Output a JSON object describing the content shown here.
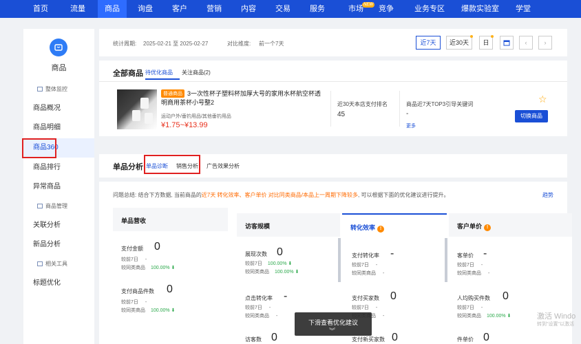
{
  "nav": {
    "items": [
      "首页",
      "流量",
      "商品",
      "询盘",
      "客户",
      "营销",
      "内容",
      "交易",
      "服务",
      "市场",
      "竞争",
      "业务专区",
      "爆款实验室",
      "学堂"
    ],
    "active_index": 2,
    "new_badge": "NEW"
  },
  "sidebar": {
    "brand_label": "商品",
    "items": [
      {
        "label": "整体监控",
        "group": true
      },
      {
        "label": "商品概况"
      },
      {
        "label": "商品明细"
      },
      {
        "label": "商品360",
        "active": true
      },
      {
        "label": "商品排行"
      },
      {
        "label": "异常商品"
      },
      {
        "label": "商品管理",
        "group": true
      },
      {
        "label": "关联分析"
      },
      {
        "label": "新品分析"
      },
      {
        "label": "相关工具",
        "group": true
      },
      {
        "label": "标题优化"
      }
    ]
  },
  "period": {
    "stat_label": "统计周期:",
    "stat_range": "2025-02-21 至 2025-02-27",
    "compare_label": "对比维度:",
    "compare_value": "前一个7天",
    "btn_7d": "近7天",
    "btn_30d": "近30天",
    "btn_day": "日"
  },
  "products": {
    "title": "全部商品",
    "tab_optimize": "待优化商品",
    "tab_follow": "关注商品(2)",
    "tag": "普通商品",
    "name": "3一次性杯子塑料杯加厚大号的家用水杯航空杯透明商用茶杯小号整2",
    "category": "运动户外/垂钓用品/其他垂钓用品",
    "price": "¥1.75~¥13.99",
    "rank_label": "近30天本店支付排名",
    "rank_value": "45",
    "keyword_label": "商品近7天TOP3引导关键词",
    "keyword_value": "-",
    "more": "更多",
    "switch_btn": "切换商品"
  },
  "analysis": {
    "title": "单品分析",
    "tab_diag": "单品诊断",
    "tab_sales": "销售分析",
    "tab_ads": "广告效果分析"
  },
  "summary": {
    "prefix": "问题总结: 结合下方数据, 当前商品的",
    "highlight": "近7天 转化效率、客户单价 对比同类商品/本品上一周期下降较多",
    "suffix": ", 可以根据下面的优化建议进行提升。",
    "trend": "趋势"
  },
  "cards": {
    "sales": {
      "title": "单品营收",
      "pay_amount_label": "支付金额",
      "pay_amount_value": "0",
      "prev7": "较前7日",
      "prev7_value": "-",
      "peer": "较同类商品",
      "peer_value": "100.00%",
      "pay_count_label": "支付商品件数",
      "pay_count_value": "0",
      "prev7_2_value": "-",
      "peer_2_value": "100.00%"
    },
    "visitors": {
      "title": "访客规模",
      "exposure_label": "展现次数",
      "exposure_value": "0",
      "exp_prev7": "100.00%",
      "exp_peer": "100.00%",
      "ctr_label": "点击转化率",
      "ctr_value": "-",
      "ctr_prev7": "-",
      "ctr_peer": "-",
      "uv_label": "访客数",
      "uv_value": "0"
    },
    "conversion": {
      "title": "转化效率",
      "pay_rate_label": "支付转化率",
      "pay_rate_value": "-",
      "pr_prev7": "-",
      "pr_peer": "-",
      "buyers_label": "支付买家数",
      "buyers_value": "0",
      "b_prev7": "-",
      "b_peer": "-",
      "new_buyers_label": "支付新买家数",
      "new_buyers_value": "0"
    },
    "unit_price": {
      "title": "客户单价",
      "aov_label": "客单价",
      "aov_value": "-",
      "aov_prev7": "-",
      "aov_peer": "-",
      "per_label": "人均购买件数",
      "per_value": "0",
      "per_prev7": "-",
      "per_peer": "100.00%",
      "unit_label": "件单价",
      "unit_value": "0"
    }
  },
  "tooltip": "下滑查看优化建议",
  "watermark": {
    "line1": "激活 Windo",
    "line2": "转到\"设置\"以激活"
  }
}
